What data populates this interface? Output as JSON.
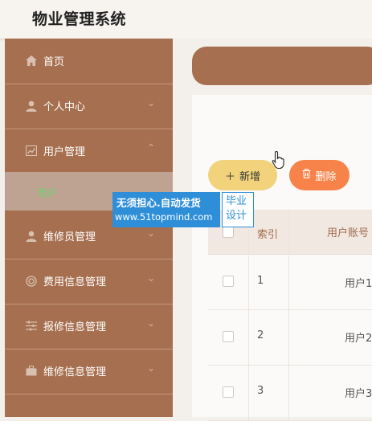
{
  "header": {
    "title": "物业管理系统"
  },
  "sidebar": {
    "items": [
      {
        "label": "首页",
        "icon": "home-icon"
      },
      {
        "label": "个人中心",
        "icon": "person-icon",
        "chevron": "⌄"
      },
      {
        "label": "用户管理",
        "icon": "chart-icon",
        "chevron": "⌃"
      },
      {
        "label": "维修员管理",
        "icon": "person-icon",
        "chevron": "⌄"
      },
      {
        "label": "费用信息管理",
        "icon": "circle-icon",
        "chevron": "⌄"
      },
      {
        "label": "报修信息管理",
        "icon": "sliders-icon",
        "chevron": "⌄"
      },
      {
        "label": "维修信息管理",
        "icon": "briefcase-icon",
        "chevron": "⌄"
      }
    ],
    "sub_item": {
      "label": "用户"
    }
  },
  "toolbar": {
    "add_label": "新增",
    "delete_label": "删除"
  },
  "table": {
    "headers": {
      "index": "索引",
      "account": "用户账号"
    },
    "rows": [
      {
        "index": "1",
        "account": "用户1"
      },
      {
        "index": "2",
        "account": "用户2"
      },
      {
        "index": "3",
        "account": "用户3"
      }
    ]
  },
  "watermark": {
    "line1": "无须担心.自动发货",
    "line2": "www.51topmind.com",
    "right": "毕业设计"
  },
  "colors": {
    "brand": "#a66f4f",
    "add_button": "#f2d37b",
    "delete_button": "#f7834a",
    "active_submenu_text": "#6fd06f"
  }
}
